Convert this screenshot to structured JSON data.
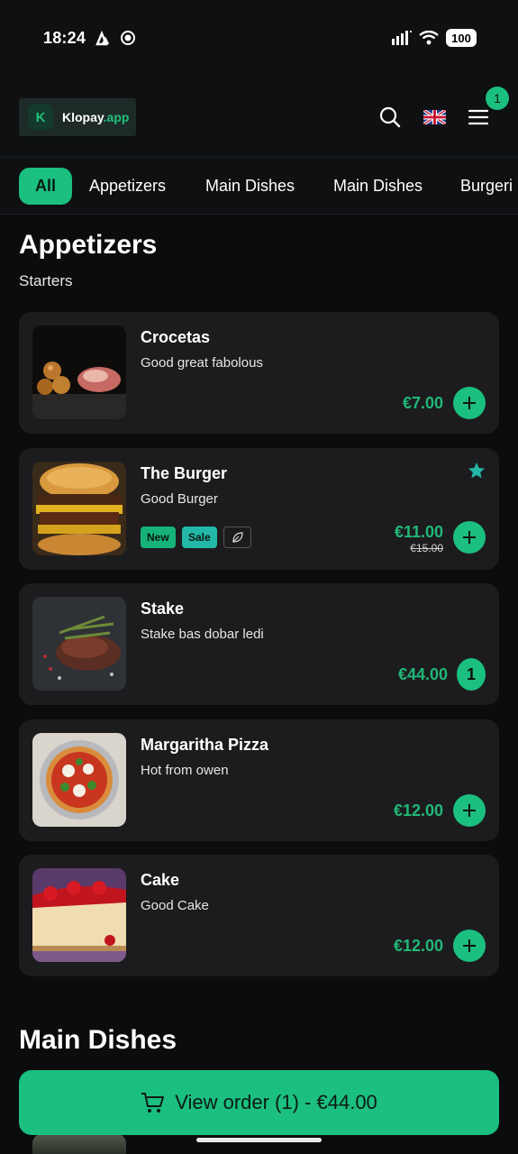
{
  "status_bar": {
    "time": "18:24",
    "battery": "100"
  },
  "header": {
    "logo_letter": "K",
    "logo_name": "Klopay",
    "logo_suffix": ".app",
    "cart_count": "1"
  },
  "tabs": [
    {
      "label": "All",
      "active": true
    },
    {
      "label": "Appetizers"
    },
    {
      "label": "Main Dishes"
    },
    {
      "label": "Main Dishes"
    },
    {
      "label": "Burgeri"
    }
  ],
  "sections": [
    {
      "title": "Appetizers",
      "subtitle": "Starters",
      "items": [
        {
          "name": "Crocetas",
          "description": "Good great fabolous",
          "price": "€7.00"
        },
        {
          "name": "The Burger",
          "description": "Good Burger",
          "price": "€11.00",
          "old_price": "€15.00",
          "tags": [
            "New",
            "Sale"
          ],
          "favorite": true
        },
        {
          "name": "Stake",
          "description": "Stake bas dobar ledi",
          "price": "€44.00",
          "quantity": "1"
        },
        {
          "name": "Margaritha Pizza",
          "description": "Hot from owen",
          "price": "€12.00"
        },
        {
          "name": "Cake",
          "description": "Good Cake",
          "price": "€12.00"
        }
      ]
    },
    {
      "title": "Main Dishes"
    }
  ],
  "order_button": {
    "label": "View order (1) - €44.00"
  },
  "colors": {
    "accent": "#1bbf7f",
    "price": "#20b877",
    "card": "#1c1c1e",
    "background": "#0b0c0d",
    "favorite": "#23b7a8"
  },
  "icons": [
    "strava-icon",
    "record-icon",
    "signal-icon",
    "wifi-icon",
    "search-icon",
    "uk-flag-icon",
    "menu-icon",
    "plus-icon",
    "star-icon",
    "leaf-icon",
    "cart-icon"
  ]
}
